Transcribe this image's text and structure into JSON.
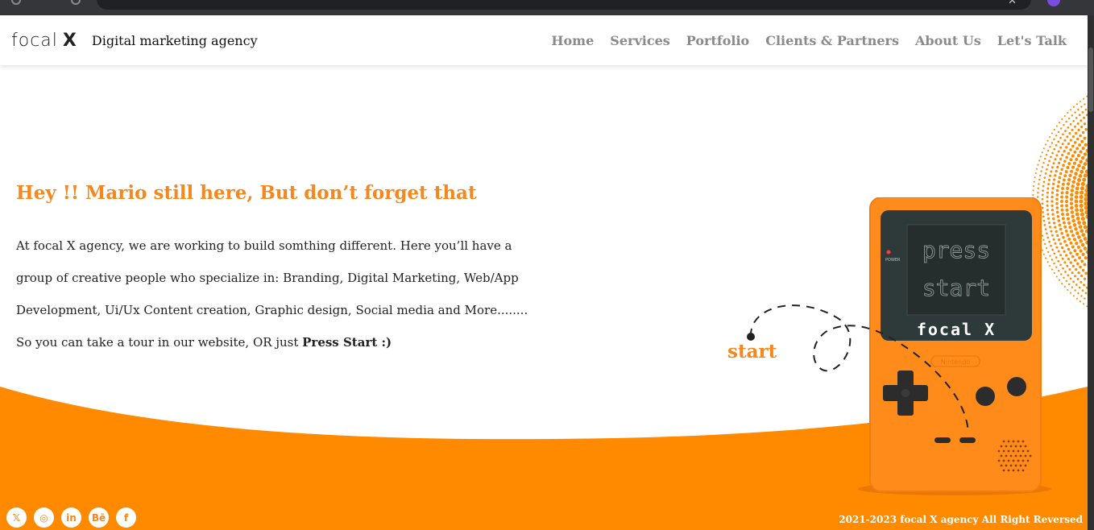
{
  "header": {
    "logo_text": "focal",
    "logo_mark": "X",
    "tagline": "Digital marketing agency",
    "nav": [
      {
        "label": "Home"
      },
      {
        "label": "Services"
      },
      {
        "label": "Portfolio"
      },
      {
        "label": "Clients & Partners"
      },
      {
        "label": "About Us"
      },
      {
        "label": "Let's Talk"
      }
    ]
  },
  "hero": {
    "title": "Hey !! Mario still here, But don’t forget that",
    "lines": [
      "At focal X agency, we are working to build somthing different. Here you’ll have a",
      "group of creative people who specialize in: Branding, Digital Marketing, Web/App",
      "Development, Ui/Ux Content creation, Graphic design, Social media and More........"
    ],
    "last_line_prefix": "So you can take a tour in our website, OR just ",
    "last_line_bold": "Press Start :)"
  },
  "console": {
    "screen_line_1": "press",
    "screen_line_2": "start",
    "brand": "focal X",
    "power_label": "POWER",
    "maker_label": "Nintendo"
  },
  "start_label": "start",
  "footer": {
    "socials": [
      {
        "icon": "x-twitter-icon",
        "glyph": "𝕏"
      },
      {
        "icon": "instagram-icon",
        "glyph": "◎"
      },
      {
        "icon": "linkedin-icon",
        "glyph": "in"
      },
      {
        "icon": "behance-icon",
        "glyph": "Bē"
      },
      {
        "icon": "facebook-icon",
        "glyph": "f"
      }
    ],
    "copyright": "2021-2023 focal X agency All Right Reversed"
  },
  "colors": {
    "accent": "#f5871f",
    "wave": "#ff8a00",
    "console_body": "#ff8c1a",
    "screen": "#2e3a3a"
  }
}
